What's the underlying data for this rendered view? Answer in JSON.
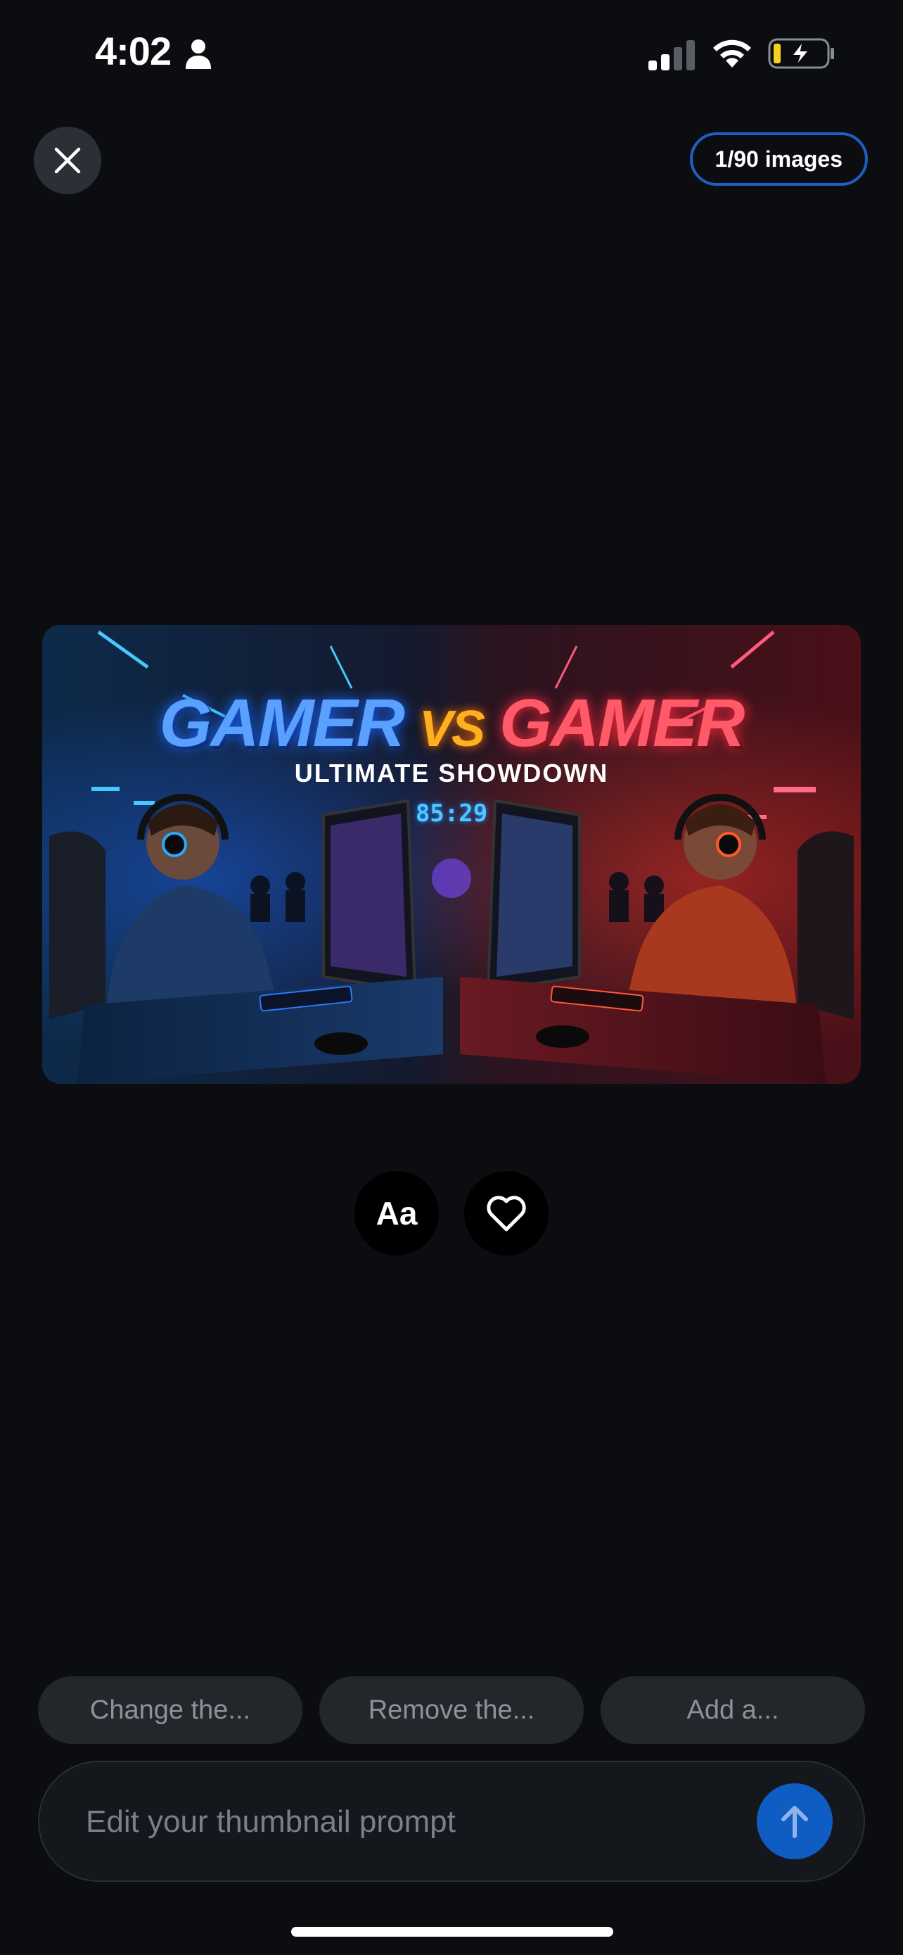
{
  "status_bar": {
    "time": "4:02"
  },
  "header": {
    "image_count": "1/90 images"
  },
  "thumbnail": {
    "title_left": "GAMER",
    "title_vs": "VS",
    "title_right": "GAMER",
    "subtitle": "ULTIMATE SHOWDOWN",
    "timer": "85:29"
  },
  "actions": {
    "text_style_label": "Aa"
  },
  "suggestions": [
    {
      "label": "Change the..."
    },
    {
      "label": "Remove the..."
    },
    {
      "label": "Add a..."
    }
  ],
  "prompt": {
    "placeholder": "Edit your thumbnail prompt",
    "value": ""
  },
  "icons": {
    "person": "person-icon",
    "signal": "cellular-signal-icon",
    "wifi": "wifi-icon",
    "battery": "battery-charging-icon",
    "close": "close-icon",
    "favorite": "heart-icon",
    "send": "arrow-up-icon"
  },
  "colors": {
    "background": "#0b0d11",
    "badge_border": "#1f5fc0",
    "send_button": "#0f5cc2",
    "chip_background": "#23262b",
    "chip_text": "#8e9198",
    "battery_charge": "#f5d020"
  }
}
